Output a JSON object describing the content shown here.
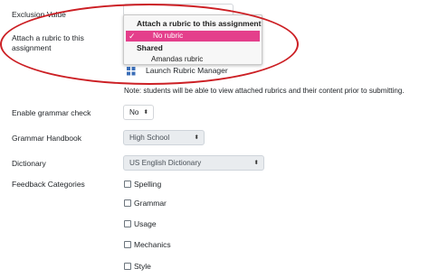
{
  "exclusion": {
    "label": "Exclusion Value"
  },
  "rubric": {
    "label": "Attach a rubric to this assignment",
    "dropdown": {
      "header": "Attach a rubric to this assignment",
      "selected_option": "No rubric",
      "group_label": "Shared",
      "options": [
        "Amandas rubric"
      ]
    },
    "launch_label": "Launch Rubric Manager",
    "note": "Note: students will be able to view attached rubrics and their content prior to submitting."
  },
  "grammar_check": {
    "label": "Enable grammar check",
    "value": "No"
  },
  "handbook": {
    "label": "Grammar Handbook",
    "value": "High School"
  },
  "dictionary": {
    "label": "Dictionary",
    "value": "US English Dictionary"
  },
  "feedback": {
    "label": "Feedback Categories",
    "options": [
      "Spelling",
      "Grammar",
      "Usage",
      "Mechanics",
      "Style"
    ]
  },
  "colors": {
    "highlight": "#e43f8b",
    "annotation": "#cc1f24"
  }
}
